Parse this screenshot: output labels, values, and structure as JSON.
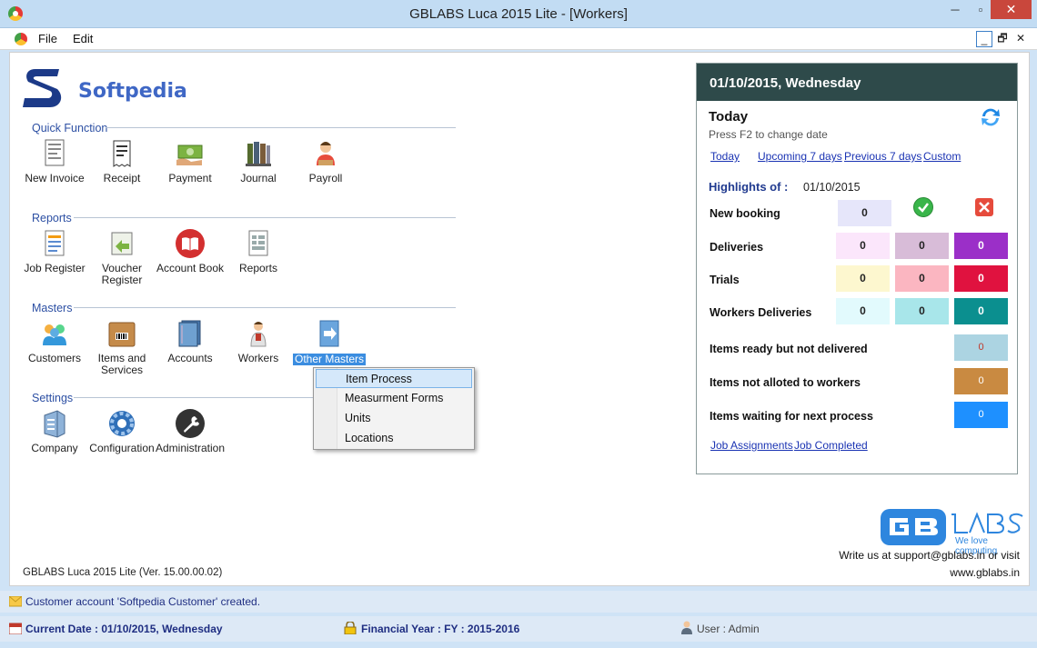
{
  "window": {
    "title": "GBLABS Luca 2015 Lite - [Workers]",
    "close_glyph": "✕",
    "minimize_glyph": "─",
    "restore_glyph": "▫"
  },
  "menubar": {
    "items": [
      "File",
      "Edit"
    ],
    "mdi_minimize": "_",
    "mdi_restore": "🗗",
    "mdi_close": "✕"
  },
  "logo": {
    "text": "Softpedia"
  },
  "sections": {
    "quick_function": {
      "title": "Quick Function",
      "items": [
        "New Invoice",
        "Receipt",
        "Payment",
        "Journal",
        "Payroll"
      ]
    },
    "reports": {
      "title": "Reports",
      "items": [
        "Job Register",
        "Voucher Register",
        "Account Book",
        "Reports"
      ]
    },
    "masters": {
      "title": "Masters",
      "items": [
        "Customers",
        "Items and Services",
        "Accounts",
        "Workers",
        "Other Masters"
      ]
    },
    "settings": {
      "title": "Settings",
      "items": [
        "Company",
        "Configuration",
        "Administration"
      ]
    }
  },
  "context_menu": {
    "items": [
      "Item Process",
      "Measurment Forms",
      "Units",
      "Locations"
    ]
  },
  "version": "GBLABS Luca 2015 Lite (Ver. 15.00.00.02)",
  "panel": {
    "header_date": "01/10/2015, Wednesday",
    "today_title": "Today",
    "hint": "Press F2 to change date",
    "links": [
      "Today",
      "Upcoming 7 days",
      "Previous 7 days",
      "Custom"
    ],
    "highlights_label": "Highlights of :",
    "highlights_date": "01/10/2015",
    "rows": [
      {
        "label": "New booking",
        "values": [
          "0"
        ],
        "colors": [
          "#e6e6fa"
        ]
      },
      {
        "label": "Deliveries",
        "values": [
          "0",
          "0",
          "0"
        ],
        "colors": [
          "#fbe6fb",
          "#d8bcd8",
          "#9b2fc8"
        ]
      },
      {
        "label": "Trials",
        "values": [
          "0",
          "0",
          "0"
        ],
        "colors": [
          "#fdf7cf",
          "#fbb6c1",
          "#e0123f"
        ]
      },
      {
        "label": "Workers Deliveries",
        "values": [
          "0",
          "0",
          "0"
        ],
        "colors": [
          "#e2fafd",
          "#a8e6ea",
          "#0b8f8f"
        ]
      }
    ],
    "single_rows": [
      {
        "label": "Items ready but not delivered",
        "value": "0",
        "color": "#acd4e2"
      },
      {
        "label": "Items not alloted to workers",
        "value": "0",
        "color": "#c98a41"
      },
      {
        "label": "Items waiting for next process",
        "value": "0",
        "color": "#1e90ff"
      }
    ],
    "footer_links": [
      "Job Assignments",
      "Job Completed"
    ]
  },
  "branding": {
    "tagline": "We love computing",
    "contact": "Write us at support@gblabs.in or visit",
    "website": "www.gblabs.in"
  },
  "status": {
    "message": "Customer account 'Softpedia Customer' created.",
    "current_date": "Current Date : 01/10/2015, Wednesday",
    "financial_year": "Financial Year : FY : 2015-2016",
    "user": "User : Admin"
  }
}
